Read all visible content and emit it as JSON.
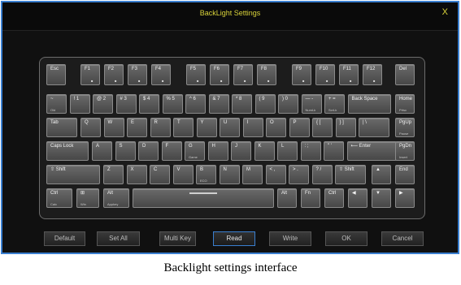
{
  "window": {
    "title": "BackLight Settings",
    "close_label": "X"
  },
  "caption": "Backlight settings interface",
  "colors": {
    "accent": "#3a7fd0",
    "title_text": "#d8d23a",
    "key_face": "#5a5a5a",
    "frame": "#101010"
  },
  "buttons": {
    "default": "Default",
    "set_all": "Set All",
    "multi_key": "Multi Key",
    "read": "Read",
    "write": "Write",
    "ok": "OK",
    "cancel": "Cancel"
  },
  "keys": {
    "esc": {
      "label": "Esc"
    },
    "f1": {
      "label": "F1"
    },
    "f2": {
      "label": "F2"
    },
    "f3": {
      "label": "F3"
    },
    "f4": {
      "label": "F4"
    },
    "f5": {
      "label": "F5"
    },
    "f6": {
      "label": "F6"
    },
    "f7": {
      "label": "F7"
    },
    "f8": {
      "label": "F8"
    },
    "f9": {
      "label": "F9"
    },
    "f10": {
      "label": "F10"
    },
    "f11": {
      "label": "F11"
    },
    "f12": {
      "label": "F12"
    },
    "del": {
      "label": "Del"
    },
    "tilde": {
      "label": "~",
      "sub": "Old"
    },
    "n1": {
      "label": "! 1"
    },
    "n2": {
      "label": "@ 2"
    },
    "n3": {
      "label": "# 3"
    },
    "n4": {
      "label": "$ 4"
    },
    "n5": {
      "label": "% 5"
    },
    "n6": {
      "label": "^ 6"
    },
    "n7": {
      "label": "& 7"
    },
    "n8": {
      "label": "* 8"
    },
    "n9": {
      "label": "( 9"
    },
    "n0": {
      "label": ") 0"
    },
    "minus": {
      "label": "— -",
      "sub": "NumLk"
    },
    "equal": {
      "label": "+ =",
      "sub": "ScrLk"
    },
    "backspace": {
      "label": "Back Space"
    },
    "home": {
      "label": "Home",
      "sub": "Prtsc"
    },
    "tab": {
      "label": "Tab"
    },
    "q": {
      "label": "Q"
    },
    "w": {
      "label": "W"
    },
    "e": {
      "label": "E"
    },
    "r": {
      "label": "R"
    },
    "t": {
      "label": "T"
    },
    "y": {
      "label": "Y"
    },
    "u": {
      "label": "U"
    },
    "i": {
      "label": "I"
    },
    "o": {
      "label": "O"
    },
    "p": {
      "label": "P"
    },
    "lbracket": {
      "label": "{ ["
    },
    "rbracket": {
      "label": "} ]"
    },
    "backslash": {
      "label": "| \\"
    },
    "pgup": {
      "label": "PgUp",
      "sub": "Pause"
    },
    "capslock": {
      "label": "Caps Lock"
    },
    "a": {
      "label": "A"
    },
    "s": {
      "label": "S"
    },
    "d": {
      "label": "D"
    },
    "f": {
      "label": "F"
    },
    "g": {
      "label": "G",
      "sub": "Game"
    },
    "h": {
      "label": "H"
    },
    "j": {
      "label": "J"
    },
    "k": {
      "label": "K"
    },
    "l": {
      "label": "L"
    },
    "semicolon": {
      "label": ": ;"
    },
    "quote": {
      "label": "\" '"
    },
    "enter": {
      "label": "⟵ Enter"
    },
    "pgdn": {
      "label": "PgDn",
      "sub": "Insert"
    },
    "lshift": {
      "label": "⇧ Shift"
    },
    "z": {
      "label": "Z"
    },
    "x": {
      "label": "X"
    },
    "c": {
      "label": "C"
    },
    "v": {
      "label": "V"
    },
    "b": {
      "label": "B",
      "sub": "ECO"
    },
    "n": {
      "label": "N"
    },
    "m": {
      "label": "M"
    },
    "comma": {
      "label": "< ,"
    },
    "period": {
      "label": "> ."
    },
    "slash": {
      "label": "? /"
    },
    "rshift": {
      "label": "⇧ Shift"
    },
    "up": {
      "label": "▲"
    },
    "end": {
      "label": "End"
    },
    "lctrl": {
      "label": "Ctrl",
      "sub": "Calc"
    },
    "win": {
      "label": "⊞",
      "sub": "Win"
    },
    "lalt": {
      "label": "Alt",
      "sub": "Appkey"
    },
    "space": {
      "label": ""
    },
    "ralt": {
      "label": "Alt"
    },
    "fn": {
      "label": "Fn"
    },
    "rctrl": {
      "label": "Ctrl"
    },
    "left": {
      "label": "◀"
    },
    "down": {
      "label": "▼"
    },
    "right": {
      "label": "▶"
    }
  }
}
